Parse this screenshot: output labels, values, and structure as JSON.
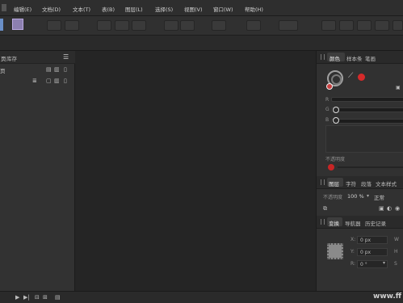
{
  "menu": {
    "items": [
      "编辑(E)",
      "文档(D)",
      "文本(T)",
      "表(B)",
      "图层(L)",
      "选择(S)",
      "视图(V)",
      "窗口(W)",
      "帮助(H)"
    ]
  },
  "left_panel": {
    "tab_partial": "页",
    "tab_stock": "库存",
    "row_partial": "页"
  },
  "right_panel": {
    "color_tabs": [
      "颜色",
      "样本条",
      "笔画"
    ],
    "slider_labels": [
      "R",
      "G",
      "B"
    ],
    "opacity_label": "不透明度",
    "text_tabs": [
      "图层",
      "字符",
      "段落",
      "文本样式"
    ],
    "opacity_field_label": "不透明度",
    "opacity_value": "100 %",
    "blend_mode": "正常",
    "transform_tabs": [
      "变换",
      "导航器",
      "历史记录"
    ],
    "transform_labels": [
      "X:",
      "Y:",
      "R:",
      "W",
      "H",
      "S"
    ],
    "transform_values": [
      "0 px",
      "0 px",
      "0 °"
    ]
  },
  "colors": {
    "accent_red": "#d52a2a",
    "bg_dark": "#252525",
    "panel": "#313131"
  },
  "watermark": "www.ff"
}
